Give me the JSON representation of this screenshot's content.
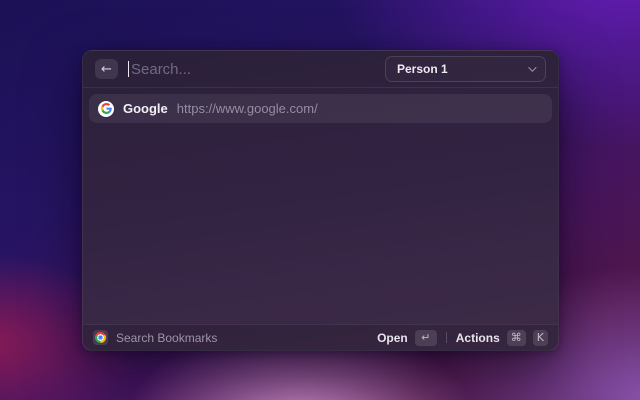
{
  "window": {
    "header": {
      "back_glyph": "←",
      "search_placeholder": "Search...",
      "search_value": "",
      "dropdown_value": "Person 1"
    },
    "list": [
      {
        "title": "Google",
        "url": "https://www.google.com/",
        "favicon": "google-g-icon"
      }
    ],
    "footer": {
      "app_icon": "chrome-icon",
      "app_label": "Search Bookmarks",
      "primary_action": "Open",
      "primary_key": "↵",
      "secondary_action": "Actions",
      "secondary_keys": [
        "⌘",
        "K"
      ]
    }
  },
  "colors": {
    "google_blue": "#4285F4",
    "google_red": "#EA4335",
    "google_yellow": "#FBBC05",
    "google_green": "#34A853",
    "window_bg_top": "#2a2038",
    "window_bg_bottom": "#3e2c48",
    "desktop_indigo": "#1b1156",
    "desktop_purple": "#661cb6",
    "desktop_pink": "#d494ce",
    "desktop_magenta": "#981b52",
    "desktop_lilac": "#965fc0"
  }
}
